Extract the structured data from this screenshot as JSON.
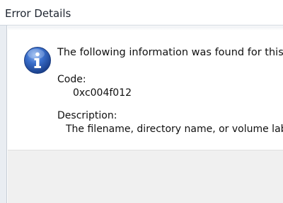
{
  "window": {
    "title": "Error Details"
  },
  "message": {
    "icon": "info-icon",
    "headline": "The following information was found for this error:",
    "code_label": "Code:",
    "code_value": "0xc004f012",
    "description_label": "Description:",
    "description_value": "The filename, directory name, or volume label syntax is incorrect."
  },
  "colors": {
    "icon_blue": "#2d5fb8",
    "frame": "#e9edf2",
    "footer": "#f0f0f0"
  }
}
